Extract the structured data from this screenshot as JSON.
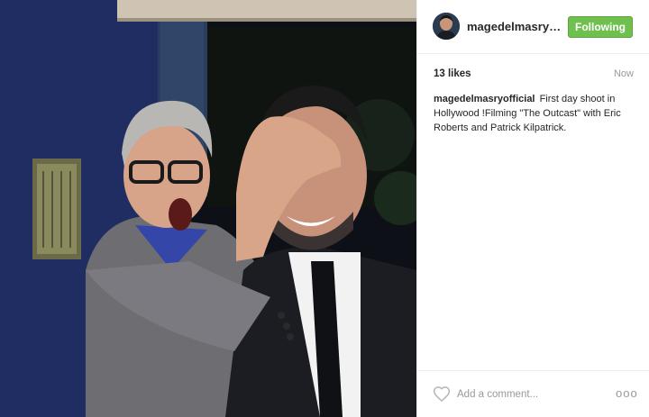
{
  "post": {
    "photo_icon": "post-photo",
    "author": {
      "username": "magedelmasryofficial",
      "avatar_icon": "profile-avatar"
    },
    "follow_button": {
      "label": "Following",
      "color": "#70c050"
    },
    "likes": "13 likes",
    "timestamp": "Now",
    "caption": {
      "author": "magedelmasryofficial",
      "text": "First day shoot in Hollywood !Filming \"The Outcast\" with Eric Roberts and Patrick Kilpatrick."
    },
    "comment_box": {
      "placeholder": "Add a comment..."
    },
    "more_options": "ooo",
    "like_icon": "heart-outline"
  }
}
